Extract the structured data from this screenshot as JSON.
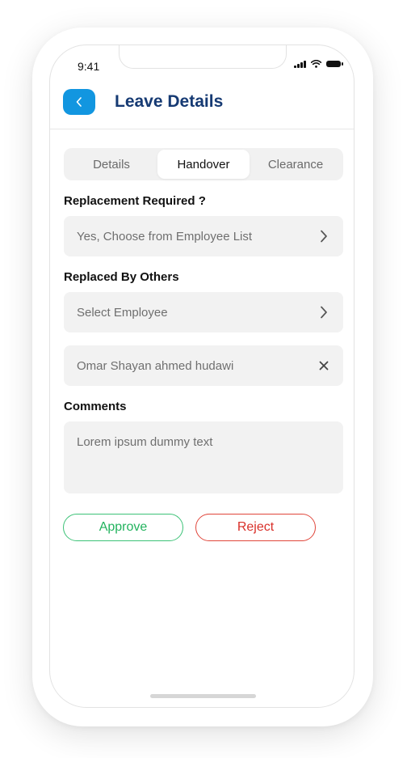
{
  "status_bar": {
    "time": "9:41"
  },
  "header": {
    "title": "Leave Details",
    "back_icon": "chevron-left-icon"
  },
  "tabs": [
    {
      "label": "Details",
      "active": false
    },
    {
      "label": "Handover",
      "active": true
    },
    {
      "label": "Clearance",
      "active": false
    }
  ],
  "form": {
    "replacement_label": "Replacement Required ?",
    "replacement_value": "Yes, Choose from Employee List",
    "replaced_by_label": "Replaced By Others",
    "select_employee_placeholder": "Select Employee",
    "selected_employee": "Omar Shayan ahmed hudawi",
    "comments_label": "Comments",
    "comments_value": "Lorem ipsum dummy text"
  },
  "actions": {
    "approve_label": "Approve",
    "reject_label": "Reject"
  },
  "colors": {
    "accent": "#1296e0",
    "title": "#163a73",
    "approve": "#22b35e",
    "reject": "#d9302a",
    "field_bg": "#f2f2f2"
  }
}
